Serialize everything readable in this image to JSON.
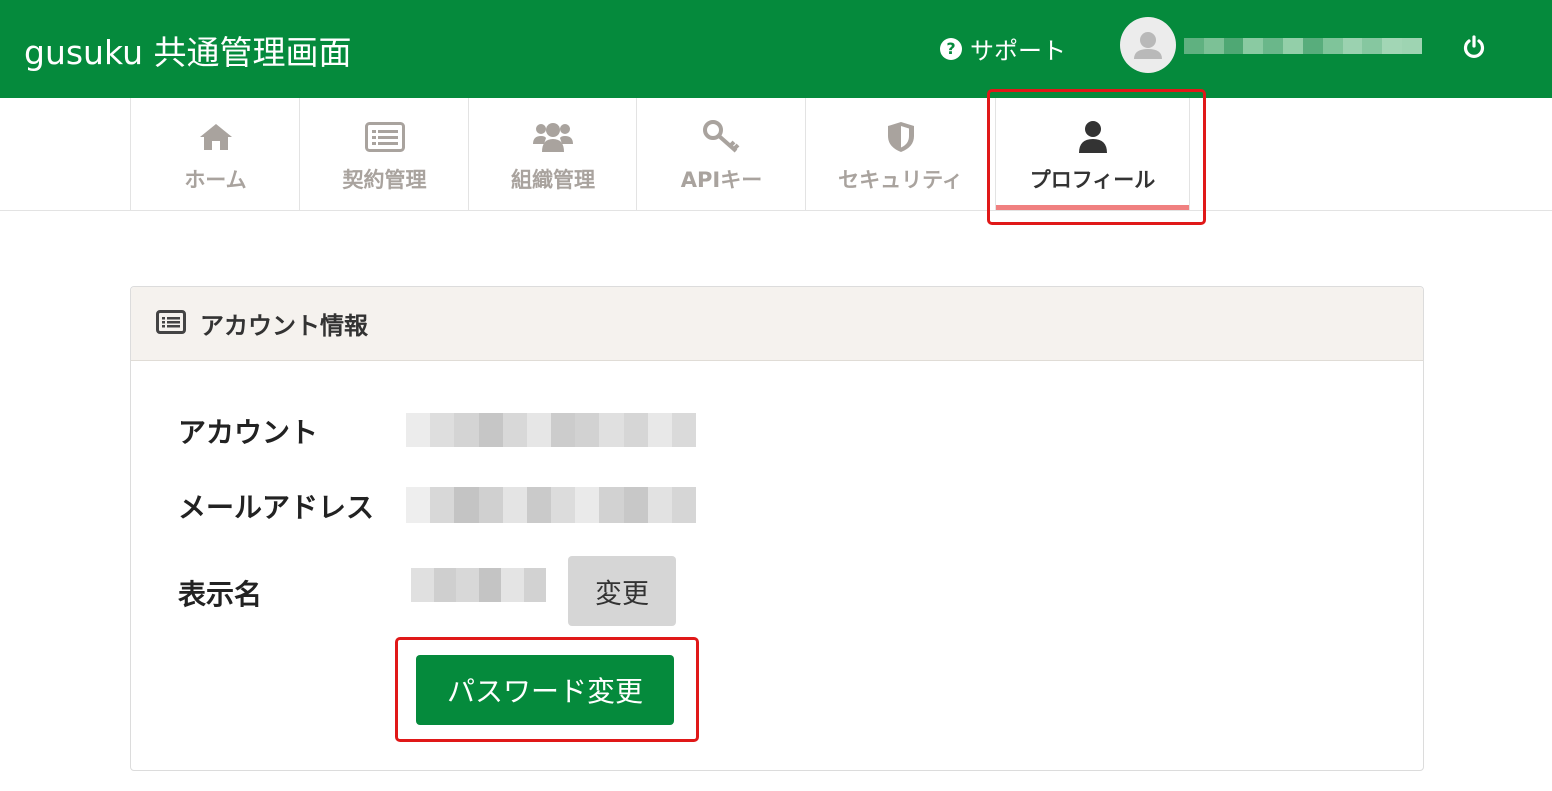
{
  "colors": {
    "brand": "#058a3c",
    "active_underline": "#f08080",
    "highlight": "#e01818"
  },
  "header": {
    "app_title": "gusuku 共通管理画面",
    "support_icon": "question-circle-icon",
    "support_label": "サポート",
    "avatar_icon": "user-avatar-icon",
    "power_icon": "power-icon"
  },
  "nav": {
    "tabs": [
      {
        "label": "ホーム",
        "icon": "home-icon",
        "active": false
      },
      {
        "label": "契約管理",
        "icon": "list-card-icon",
        "active": false
      },
      {
        "label": "組織管理",
        "icon": "users-icon",
        "active": false
      },
      {
        "label": "APIキー",
        "icon": "key-icon",
        "active": false
      },
      {
        "label": "セキュリティ",
        "icon": "shield-icon",
        "active": false
      },
      {
        "label": "プロフィール",
        "icon": "user-icon",
        "active": true
      }
    ]
  },
  "panel": {
    "title_icon": "list-card-icon",
    "title": "アカウント情報",
    "fields": [
      {
        "label": "アカウント"
      },
      {
        "label": "メールアドレス"
      },
      {
        "label": "表示名"
      }
    ],
    "change_button": "変更",
    "password_button": "パスワード変更"
  }
}
